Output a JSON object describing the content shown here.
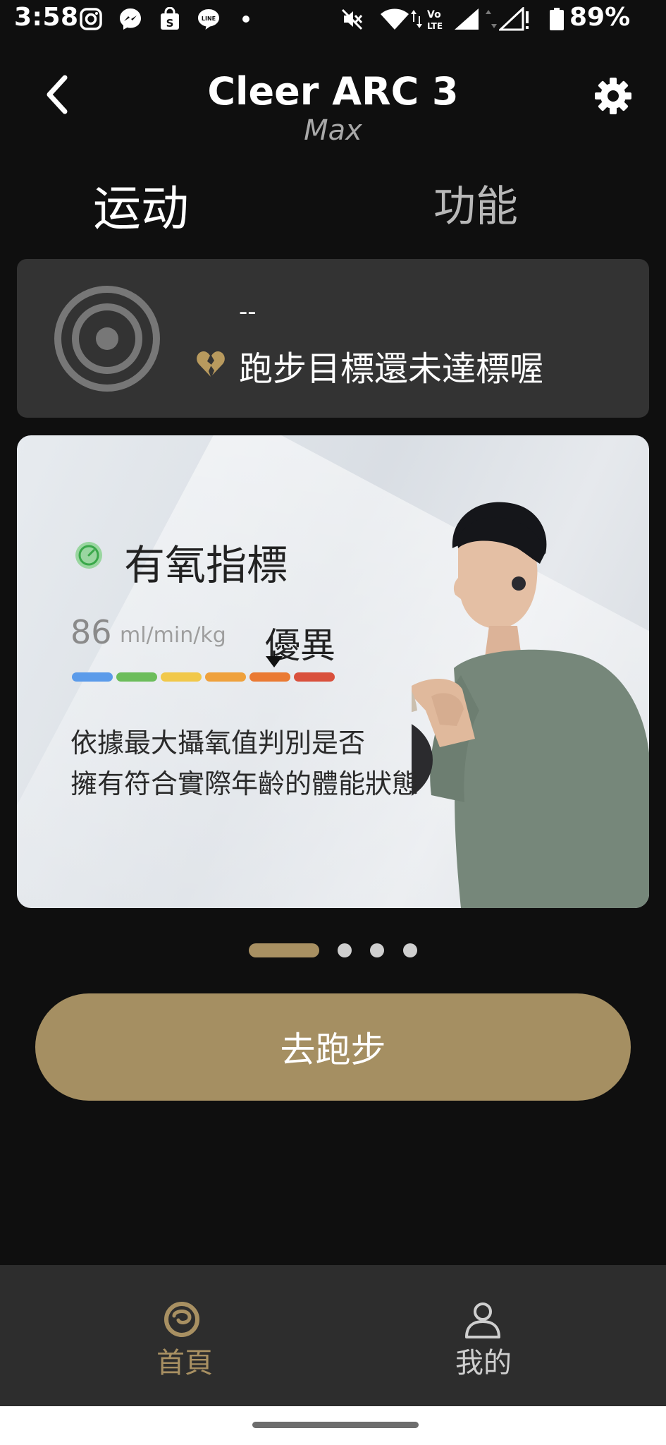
{
  "status_bar": {
    "time": "3:58",
    "battery": "89%",
    "icons": [
      "instagram-icon",
      "messenger-icon",
      "shopping-bag-icon",
      "line-icon",
      "dot-icon",
      "mute-icon",
      "wifi-icon",
      "volte-icon",
      "signal-icon",
      "signal-no-service-icon",
      "battery-icon"
    ]
  },
  "header": {
    "title": "Cleer ARC 3",
    "subtitle": "Max"
  },
  "tabs": [
    {
      "label": "运动",
      "active": true
    },
    {
      "label": "功能",
      "active": false
    }
  ],
  "goal_card": {
    "value": "--",
    "message": "跑步目標還未達標喔"
  },
  "promo": {
    "title": "有氧指標",
    "value": "86",
    "unit": "ml/min/kg",
    "level": "優異",
    "scale_colors": [
      "#5b9bea",
      "#6cbd5b",
      "#f1c84a",
      "#efa13c",
      "#ea7a33",
      "#d9503c"
    ],
    "description_lines": [
      "依據最大攝氧值判別是否",
      "擁有符合實際年齡的體能狀態"
    ]
  },
  "pagination": {
    "total": 4,
    "active": 0
  },
  "cta": {
    "label": "去跑步"
  },
  "bottom_nav": [
    {
      "label": "首頁",
      "icon": "home-logo-icon",
      "active": true
    },
    {
      "label": "我的",
      "icon": "user-icon",
      "active": false
    }
  ],
  "colors": {
    "accent": "#a58f62",
    "background": "#0f0f0f",
    "card": "#333333"
  }
}
